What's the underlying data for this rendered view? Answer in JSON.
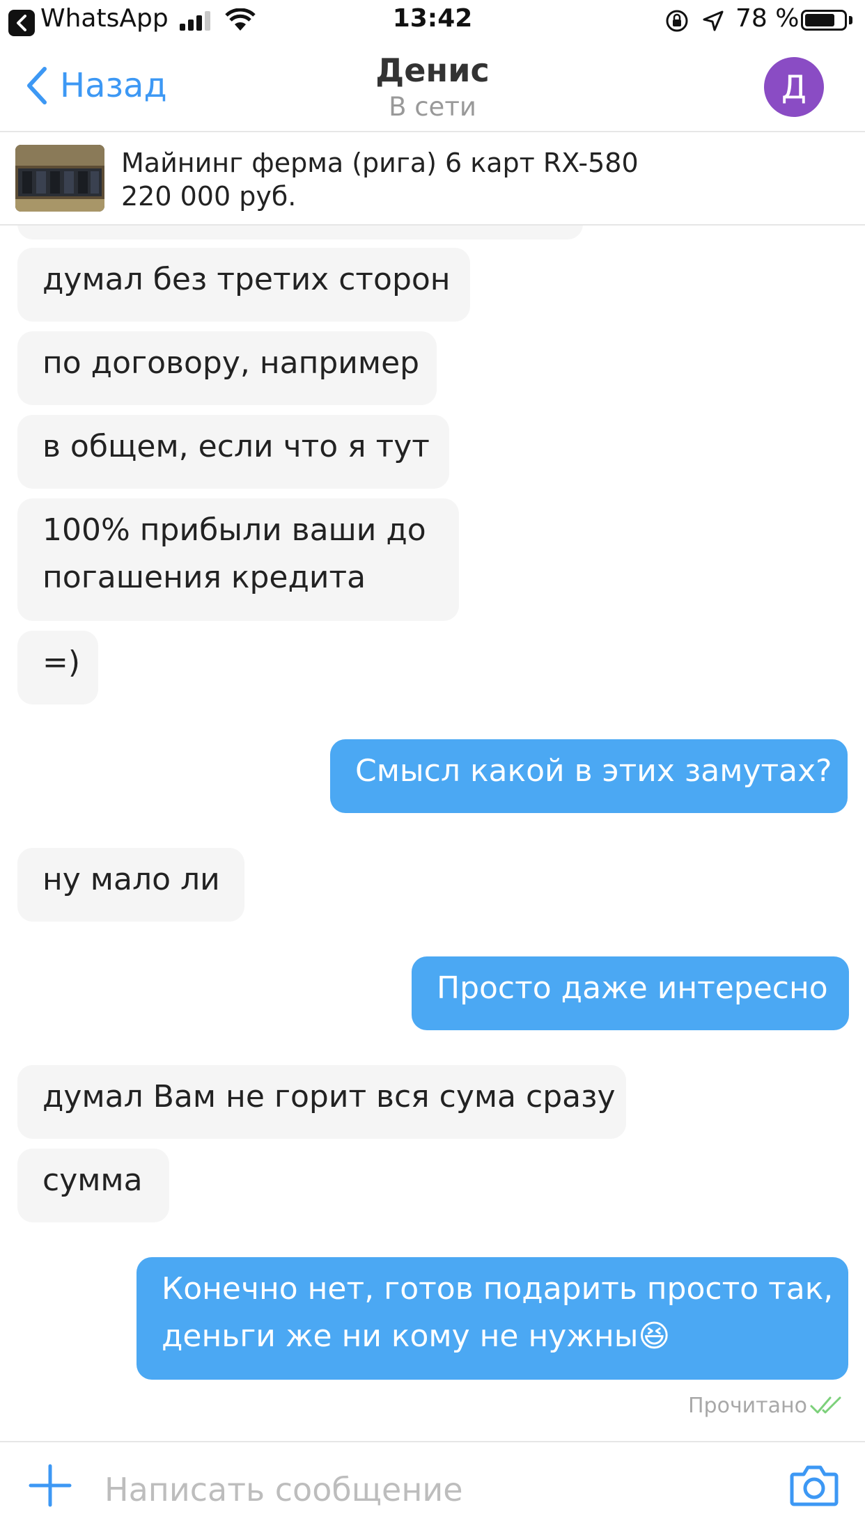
{
  "status_bar": {
    "back_app": "WhatsApp",
    "time": "13:42",
    "battery": "78 %",
    "battery_level": 0.78
  },
  "header": {
    "back_label": "Назад",
    "title": "Денис",
    "subtitle": "В сети",
    "avatar_letter": "Д",
    "avatar_color": "#8a4cc4"
  },
  "listing": {
    "title": "Майнинг ферма (рига) 6 карт RX-580",
    "price": "220 000 руб."
  },
  "messages": [
    {
      "dir": "in",
      "text": "думал без третих сторон"
    },
    {
      "dir": "in",
      "text": "по договору, например"
    },
    {
      "dir": "in",
      "text": "в общем, если что я тут"
    },
    {
      "dir": "in",
      "lines": [
        "100% прибыли ваши до",
        "погашения кредита"
      ]
    },
    {
      "dir": "in",
      "text": "=)"
    },
    {
      "dir": "out",
      "text": "Смысл какой в этих замутах?"
    },
    {
      "dir": "in",
      "text": "ну мало ли"
    },
    {
      "dir": "out",
      "text": "Просто даже интересно"
    },
    {
      "dir": "in",
      "text": "думал Вам не горит вся сума сразу"
    },
    {
      "dir": "in",
      "text": "сумма"
    },
    {
      "dir": "out",
      "lines": [
        "Конечно нет, готов подарить просто так,",
        "деньги же ни кому не нужны😆"
      ]
    }
  ],
  "read_status": "Прочитано",
  "composer": {
    "placeholder": "Написать сообщение"
  },
  "colors": {
    "accent": "#3d98f4",
    "outgoing_bubble": "#4ba8f3",
    "incoming_bubble": "#f5f5f5",
    "read_tick": "#7cd07a"
  }
}
